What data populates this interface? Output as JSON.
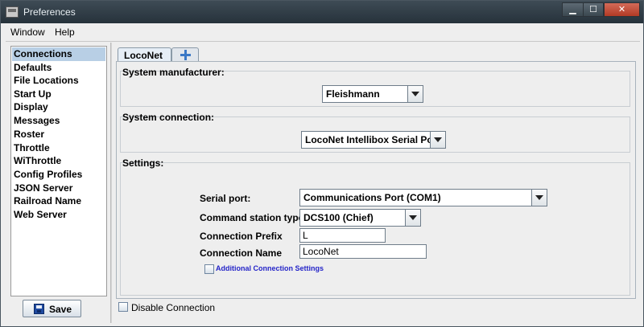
{
  "window": {
    "title": "Preferences"
  },
  "menu": [
    "Window",
    "Help"
  ],
  "sidebar": {
    "items": [
      {
        "label": "Connections"
      },
      {
        "label": "Defaults"
      },
      {
        "label": "File Locations"
      },
      {
        "label": "Start Up"
      },
      {
        "label": "Display"
      },
      {
        "label": "Messages"
      },
      {
        "label": "Roster"
      },
      {
        "label": "Throttle"
      },
      {
        "label": "WiThrottle"
      },
      {
        "label": "Config Profiles"
      },
      {
        "label": "JSON Server"
      },
      {
        "label": "Railroad Name"
      },
      {
        "label": "Web Server"
      }
    ],
    "selected_index": 0,
    "save_label": "Save"
  },
  "tabs": {
    "active_label": "LocoNet",
    "add_icon": "plus-icon"
  },
  "manufacturer": {
    "label": "System manufacturer:",
    "value": "Fleishmann"
  },
  "connection": {
    "label": "System connection:",
    "value": "LocoNet Intellibox Serial Port"
  },
  "settings": {
    "label": "Settings:",
    "serial_port": {
      "label": "Serial port:",
      "value": "Communications Port (COM1)"
    },
    "command_station": {
      "label": "Command station type:",
      "value": "DCS100 (Chief)"
    },
    "prefix": {
      "label": "Connection Prefix",
      "value": "L"
    },
    "name": {
      "label": "Connection Name",
      "value": "LocoNet"
    },
    "additional": {
      "label": "Additional Connection Settings",
      "checked": false
    }
  },
  "disable_connection": {
    "label": "Disable Connection",
    "checked": false
  },
  "colors": {
    "selection": "#b8cfe5",
    "titlebar": "#2f3b44",
    "close": "#c24b36",
    "link": "#2424c8"
  }
}
